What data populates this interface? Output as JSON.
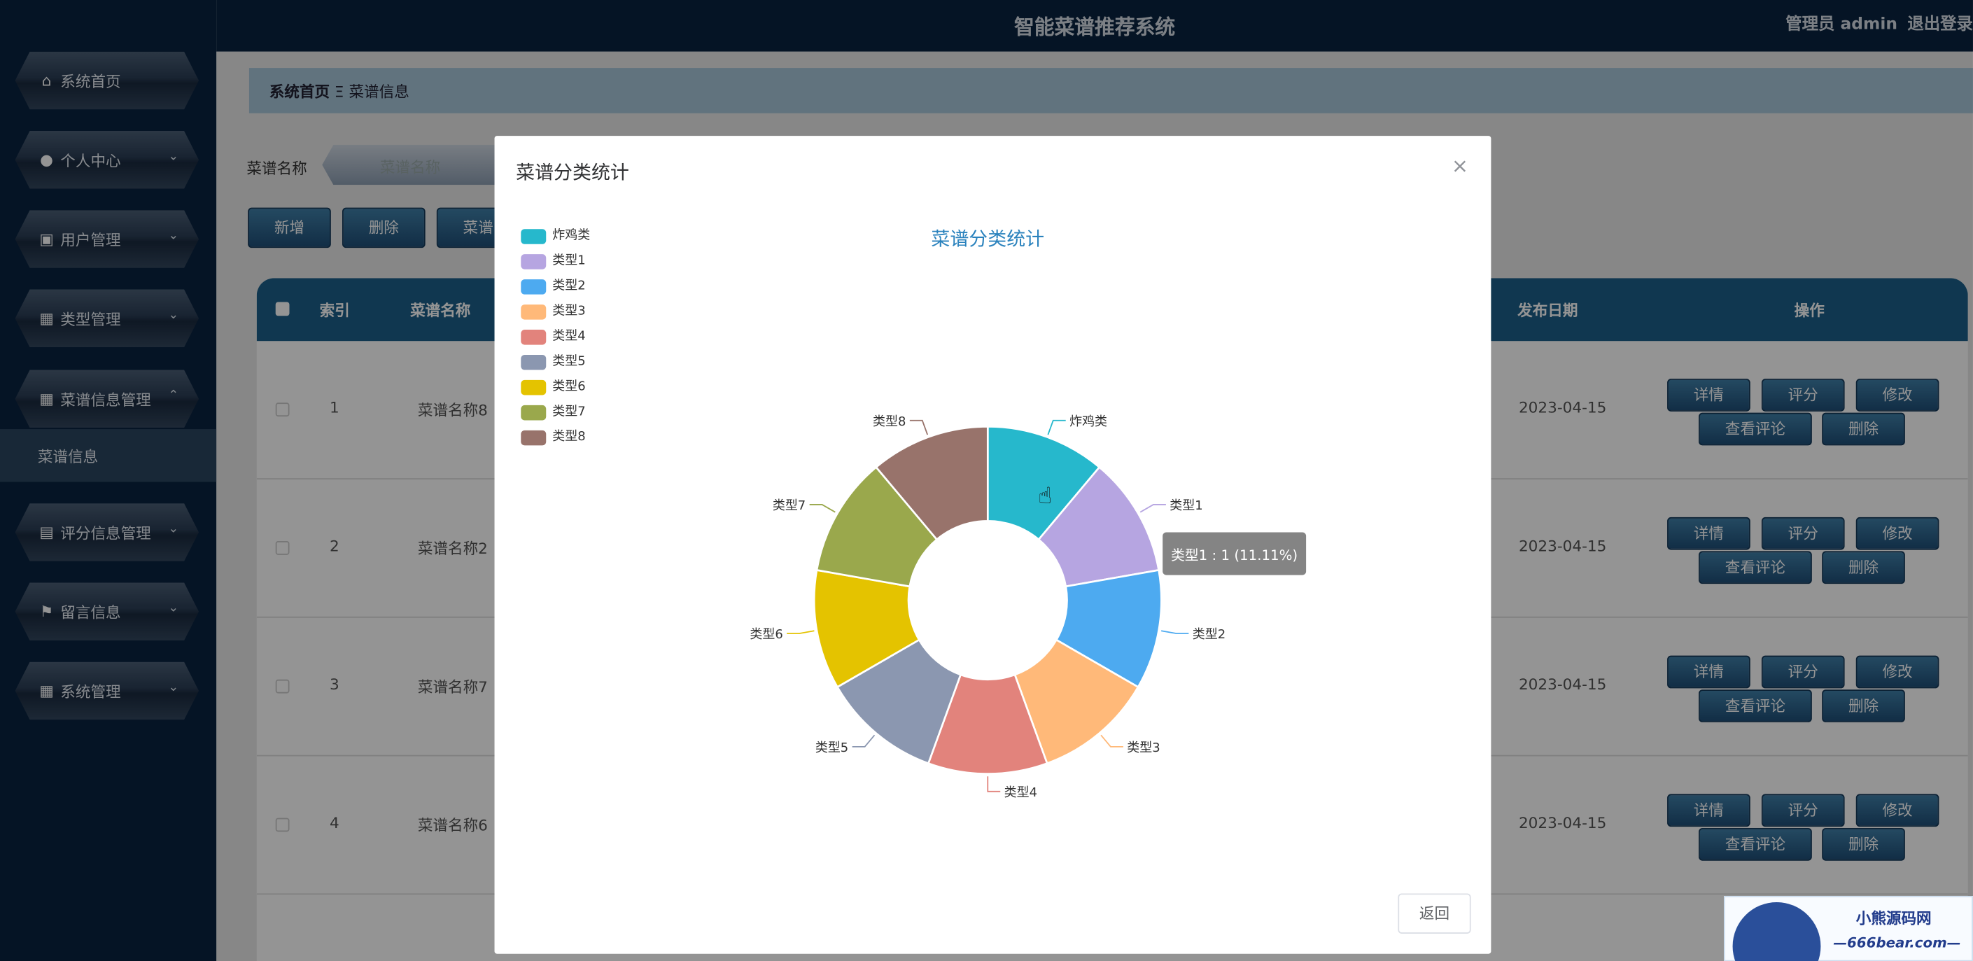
{
  "header": {
    "title": "智能菜谱推荐系统",
    "user": "管理员 admin",
    "logout": "退出登录"
  },
  "sidebar": {
    "items": [
      {
        "label": "系统首页",
        "icon": "home-icon"
      },
      {
        "label": "个人中心",
        "icon": "user-icon"
      },
      {
        "label": "用户管理",
        "icon": "clipboard-icon"
      },
      {
        "label": "类型管理",
        "icon": "grid-icon"
      },
      {
        "label": "菜谱信息管理",
        "icon": "grid-icon"
      },
      {
        "label": "评分信息管理",
        "icon": "comment-icon"
      },
      {
        "label": "留言信息",
        "icon": "flag-icon"
      },
      {
        "label": "系统管理",
        "icon": "grid-icon"
      }
    ],
    "submenu": "菜谱信息"
  },
  "breadcrumb": {
    "home": "系统首页",
    "sep": "Ξ",
    "current": "菜谱信息"
  },
  "search": {
    "label": "菜谱名称",
    "placeholder": "菜谱名称"
  },
  "toolbar": {
    "add": "新增",
    "delete": "删除",
    "third": "菜谱"
  },
  "table": {
    "headers": {
      "index": "索引",
      "name": "菜谱名称",
      "date": "发布日期",
      "ops": "操作"
    },
    "rows": [
      {
        "index": "1",
        "name": "菜谱名称8",
        "date": "2023-04-15"
      },
      {
        "index": "2",
        "name": "菜谱名称2",
        "date": "2023-04-15"
      },
      {
        "index": "3",
        "name": "菜谱名称7",
        "date": "2023-04-15"
      },
      {
        "index": "4",
        "name": "菜谱名称6",
        "date": "2023-04-15"
      }
    ],
    "actions": {
      "detail": "详情",
      "rate": "评分",
      "edit": "修改",
      "comments": "查看评论",
      "delete": "删除"
    }
  },
  "modal": {
    "title": "菜谱分类统计",
    "close": "×",
    "return": "返回"
  },
  "tooltip": "类型1 : 1 (11.11%)",
  "watermark": {
    "line1": "小熊源码网",
    "line2": "—666bear.com—"
  },
  "chart_data": {
    "type": "pie",
    "title": "菜谱分类统计",
    "legend_position": "top-left",
    "donut": true,
    "series": [
      {
        "data": [
          {
            "name": "炸鸡类",
            "value": 1,
            "color": "#26b8cc"
          },
          {
            "name": "类型1",
            "value": 1,
            "color": "#b6a5e1"
          },
          {
            "name": "类型2",
            "value": 1,
            "color": "#4daaf0"
          },
          {
            "name": "类型3",
            "value": 1,
            "color": "#ffb979"
          },
          {
            "name": "类型4",
            "value": 1,
            "color": "#e2837c"
          },
          {
            "name": "类型5",
            "value": 1,
            "color": "#8b97b0"
          },
          {
            "name": "类型6",
            "value": 1,
            "color": "#e4c300"
          },
          {
            "name": "类型7",
            "value": 1,
            "color": "#9aa84c"
          },
          {
            "name": "类型8",
            "value": 1,
            "color": "#98736b"
          }
        ]
      }
    ]
  }
}
